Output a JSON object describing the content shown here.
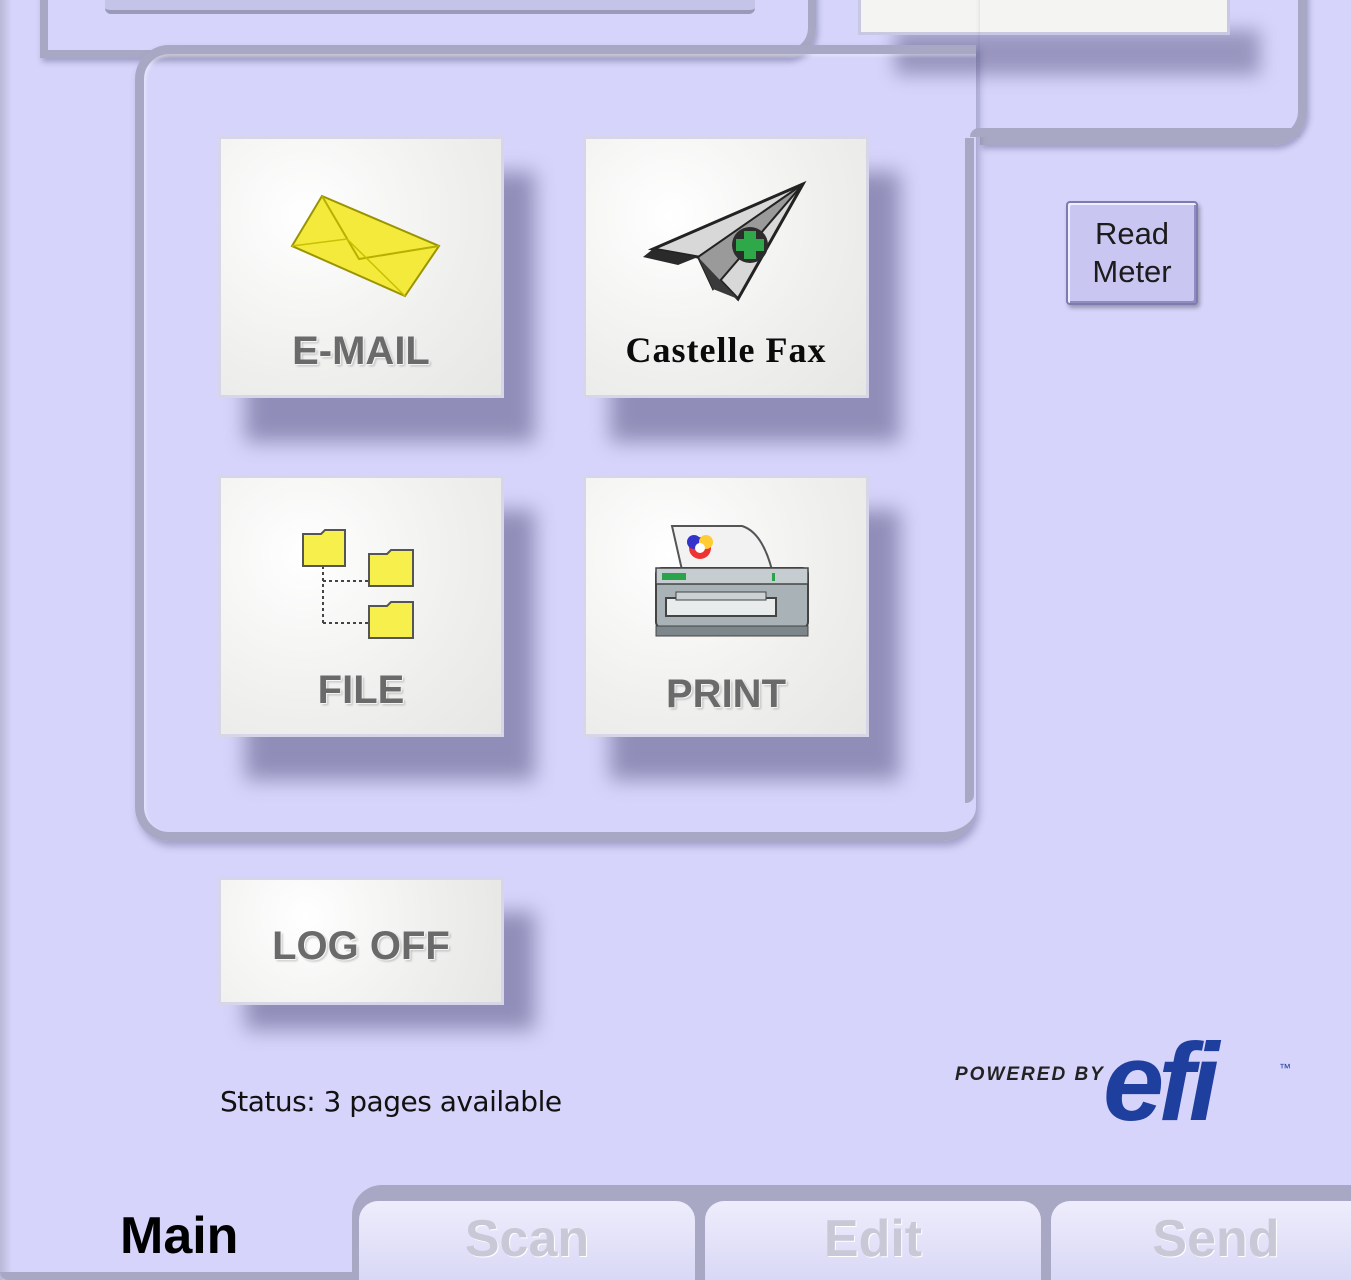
{
  "tiles": {
    "email": "E-MAIL",
    "fax": "Castelle Fax",
    "file": "FILE",
    "print": "PRINT",
    "logoff": "LOG OFF"
  },
  "read_meter": {
    "line1": "Read",
    "line2": "Meter"
  },
  "status": "Status: 3 pages available",
  "logo": {
    "powered_by": "POWERED BY",
    "brand": "efi",
    "tm": "™"
  },
  "tabs": {
    "main": "Main",
    "scan": "Scan",
    "edit": "Edit",
    "send": "Send"
  },
  "icons": [
    "envelope-icon",
    "paper-plane-fax-icon",
    "folder-tree-icon",
    "printer-icon"
  ],
  "colors": {
    "background": "#d6d4fa",
    "panel_border": "#a9a8c4",
    "button": "#c9c6f2",
    "logo_blue": "#1f3f9e"
  }
}
